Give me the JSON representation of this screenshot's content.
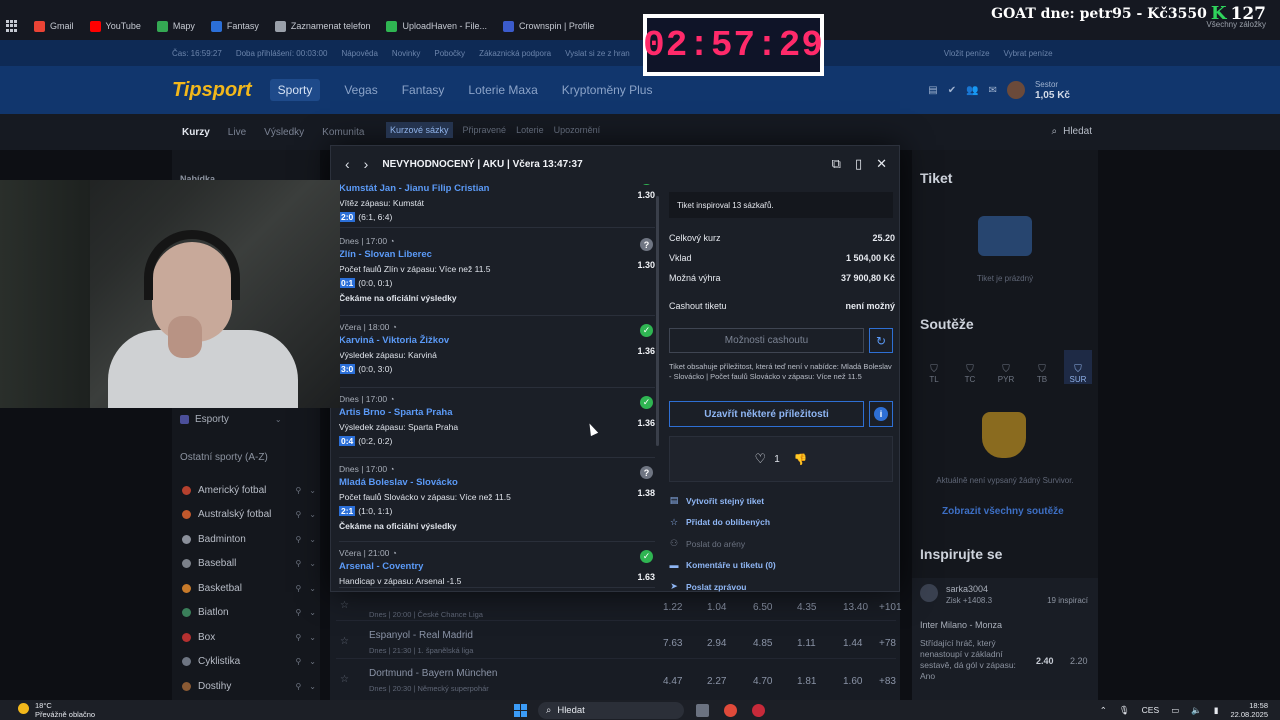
{
  "browser": {
    "bookmarks": [
      "Gmail",
      "YouTube",
      "Mapy",
      "Fantasy",
      "Zaznamenat telefon",
      "UploadHaven - File...",
      "Crownspin | Profile"
    ],
    "bookmark_colors": [
      "#ea4335",
      "#ff0000",
      "#34a853",
      "#2b6fd8",
      "#9aa0aa",
      "#2fb552",
      "#3b5bcc"
    ],
    "all_bookmarks": "Všechny záložky"
  },
  "overlay": {
    "timer": "02:57:29",
    "goat_text": "GOAT dne: petr95 - Kč3550",
    "goat_k": "K",
    "goat_number": "127"
  },
  "site": {
    "top_bar": [
      "Čas: 16:59:27",
      "Doba přihlášení: 00:03:00",
      "Nápověda",
      "Novinky",
      "Pobočky",
      "Zákaznická podpora",
      "Vyslat si ze z hran"
    ],
    "top_bar_right": [
      "Vložit peníze",
      "Vybrat peníze"
    ],
    "logo": "Tipsport",
    "nav": [
      "Sporty",
      "Vegas",
      "Fantasy",
      "Loterie Maxa",
      "Kryptoměny Plus"
    ],
    "nav_active": "Sporty",
    "account": {
      "name": "Sestor",
      "balance": "1,05 Kč"
    },
    "subnav": [
      "Kurzy",
      "Live",
      "Výsledky",
      "Komunita"
    ],
    "search": "Hledat"
  },
  "modal_tabs": [
    "Kurzové sázky",
    "Připravené",
    "Loterie",
    "Upozornění"
  ],
  "sidebar": {
    "heading": "Nabídka",
    "esports": "Esporty",
    "section": "Ostatní sporty (A-Z)",
    "sports": [
      {
        "label": "Americký fotbal",
        "color": "#b5412e"
      },
      {
        "label": "Australský fotbal",
        "color": "#c0582c"
      },
      {
        "label": "Badminton",
        "color": "#8a8f9a"
      },
      {
        "label": "Baseball",
        "color": "#7c818a"
      },
      {
        "label": "Basketbal",
        "color": "#c77a2a"
      },
      {
        "label": "Biatlon",
        "color": "#3a7f5a"
      },
      {
        "label": "Box",
        "color": "#b53030"
      },
      {
        "label": "Cyklistika",
        "color": "#6e7582"
      },
      {
        "label": "Dostihy",
        "color": "#8a5a34"
      }
    ]
  },
  "background_matches": [
    {
      "match": "",
      "sub": "Dnes | 20:00 | České Chance Liga",
      "odds": [
        "1.22",
        "1.04",
        "6.50",
        "4.35",
        "13.40",
        "+101"
      ]
    },
    {
      "match": "Espanyol - Real Madrid",
      "sub": "Dnes | 21:30 | 1. španělská liga",
      "odds": [
        "7.63",
        "2.94",
        "4.85",
        "1.11",
        "1.44",
        "+78"
      ]
    },
    {
      "match": "Dortmund - Bayern München",
      "sub": "Dnes | 20:30 | Německý superpohár",
      "odds": [
        "4.47",
        "2.27",
        "4.70",
        "1.81",
        "1.60",
        "+83"
      ]
    }
  ],
  "right_panel": {
    "ticket_title": "Tiket",
    "ticket_empty": "Tiket je prázdný",
    "competitions_title": "Soutěže",
    "comp_tabs": [
      "TL",
      "TC",
      "PYR",
      "TB",
      "SUR"
    ],
    "comp_active": "SUR",
    "comp_empty": "Aktuálně není vypsaný žádný Survivor.",
    "show_all": "Zobrazit všechny soutěže",
    "inspire_title": "Inspirujte se",
    "insp_user": "sarka3004",
    "insp_gain": "Zisk +1408.3",
    "insp_count": "19 inspirací",
    "insp_match": "Inter Milano - Monza",
    "insp_market": "Střídající hráč, který nenastoupí v základní sestavě, dá gól v zápasu: Ano",
    "insp_odds": [
      "2.40",
      "2.20"
    ]
  },
  "modal": {
    "title": "NEVYHODNOCENÝ | AKU | Včera 13:47:37",
    "legs": [
      {
        "date": "",
        "teams": "Kumstát Jan - Jianu Filip Cristian",
        "market": "Vítěz zápasu: Kumstát",
        "chip": "2:0",
        "score": "(6:1, 6:4)",
        "wait": "",
        "odd": "1.30",
        "status": "ok"
      },
      {
        "date": "Dnes | 17:00",
        "teams": "Zlín - Slovan Liberec",
        "market": "Počet faulů Zlín v zápasu: Více než 11.5",
        "chip": "0:1",
        "score": "(0:0, 0:1)",
        "wait": "Čekáme na oficiální výsledky",
        "odd": "1.30",
        "status": "q"
      },
      {
        "date": "Včera | 18:00",
        "teams": "Karviná - Viktoria Žižkov",
        "market": "Výsledek zápasu: Karviná",
        "chip": "3:0",
        "score": "(0:0, 3:0)",
        "wait": "",
        "odd": "1.36",
        "status": "ok"
      },
      {
        "date": "Dnes | 17:00",
        "teams": "Artis Brno - Sparta Praha",
        "market": "Výsledek zápasu: Sparta Praha",
        "chip": "0:4",
        "score": "(0:2, 0:2)",
        "wait": "",
        "odd": "1.36",
        "status": "ok"
      },
      {
        "date": "Dnes | 17:00",
        "teams": "Mladá Boleslav - Slovácko",
        "market": "Počet faulů Slovácko v zápasu: Více než 11.5",
        "chip": "2:1",
        "score": "(1:0, 1:1)",
        "wait": "Čekáme na oficiální výsledky",
        "odd": "1.38",
        "status": "q"
      },
      {
        "date": "Včera | 21:00",
        "teams": "Arsenal - Coventry",
        "market": "Handicap v zápasu: Arsenal -1.5",
        "chip": "",
        "score": "",
        "wait": "",
        "odd": "1.63",
        "status": "ok"
      }
    ],
    "inspired": "Tiket inspiroval 13 sázkařů.",
    "summary": [
      {
        "k": "Celkový kurz",
        "v": "25.20"
      },
      {
        "k": "Vklad",
        "v": "1 504,00 Kč"
      },
      {
        "k": "Možná výhra",
        "v": "37 900,80 Kč"
      }
    ],
    "cashout_label": "Cashout tiketu",
    "cashout_value": "není možný",
    "cashout_btn": "Možnosti cashoutu",
    "note": "Tiket obsahuje příležitost, která teď není v nabídce: Mladá Boleslav - Slovácko | Počet faulů Slovácko v zápasu: Více než 11.5",
    "close_btn": "Uzavřít některé příležitosti",
    "likes": "1",
    "actions": [
      {
        "label": "Vytvořit stejný tiket",
        "disabled": false
      },
      {
        "label": "Přidat do oblíbených",
        "disabled": false
      },
      {
        "label": "Poslat do arény",
        "disabled": true
      },
      {
        "label": "Komentáře u tiketu (0)",
        "disabled": false
      },
      {
        "label": "Poslat zprávou",
        "disabled": false
      }
    ]
  },
  "taskbar": {
    "temp": "18°C",
    "weather": "Převážně oblačno",
    "search": "Hledat",
    "lang": "CES",
    "time": "18:58",
    "date": "22.08.2025"
  }
}
